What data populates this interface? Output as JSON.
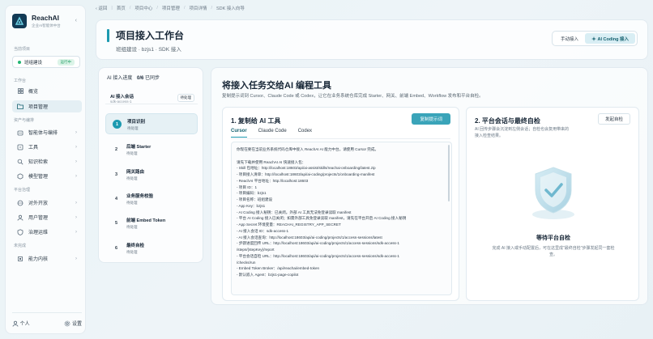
{
  "brand": {
    "name": "ReachAI",
    "subtitle": "企业AI智能体中台"
  },
  "sidebar": {
    "current_project_label": "当前项目",
    "project": {
      "name": "班组建设",
      "status": "运行中"
    },
    "groups": [
      {
        "label": "工作台"
      },
      {
        "label": "资产与编排"
      },
      {
        "label": "平台治理"
      },
      {
        "label": "未完成"
      }
    ],
    "items": [
      {
        "label": "概览",
        "icon": "grid-icon"
      },
      {
        "label": "项目管理",
        "icon": "folder-icon"
      },
      {
        "label": "智能体与编排",
        "icon": "robot-icon"
      },
      {
        "label": "工具",
        "icon": "tool-icon"
      },
      {
        "label": "知识检索",
        "icon": "search-icon"
      },
      {
        "label": "模型管理",
        "icon": "cube-icon"
      },
      {
        "label": "对外开放",
        "icon": "link-icon"
      },
      {
        "label": "用户管理",
        "icon": "user-icon"
      },
      {
        "label": "治理运维",
        "icon": "shield-icon"
      },
      {
        "label": "能力内核",
        "icon": "chip-icon"
      }
    ],
    "footer": {
      "personal": "个人",
      "settings": "设置"
    }
  },
  "breadcrumb": [
    "返回",
    "首页",
    "项目中心",
    "项目管理",
    "项目详情",
    "SDK 接入向导"
  ],
  "header": {
    "title": "项目接入工作台",
    "subtitle": "班组建设 · bzjs1 · SDK 接入",
    "mode_manual": "手动接入",
    "mode_ai": "AI Coding 接入"
  },
  "steps_panel": {
    "label": "AI 接入进度",
    "progress": "0/6",
    "status": "已同步",
    "session": {
      "title": "AI 接入会话",
      "id": "sdk-access-1",
      "badge": "待处理"
    },
    "steps": [
      {
        "num": "1",
        "title": "项目识别",
        "status": "待处理"
      },
      {
        "num": "2",
        "title": "后端 Starter",
        "status": "待处理"
      },
      {
        "num": "3",
        "title": "网关路由",
        "status": "待处理"
      },
      {
        "num": "4",
        "title": "业务服务校验",
        "status": "待处理"
      },
      {
        "num": "5",
        "title": "前端 Embed Token",
        "status": "待处理"
      },
      {
        "num": "6",
        "title": "最终自检",
        "status": "待处理"
      }
    ]
  },
  "main": {
    "title": "将接入任务交给AI 编程工具",
    "description": "复制提示词到 Cursor、Claude Code 或 Codex，让它在业务系统仓库完成 Starter、网关、前端 Embed、Workflow 发布和平台自检。",
    "card1": {
      "title": "1. 复制给 AI 工具",
      "copy_button": "复制提示词",
      "tabs": [
        "Cursor",
        "Claude Code",
        "Codex"
      ],
      "lines": [
        "你现在要在当前业务系统代码仓库中接入 ReachAI AI 能力中台。请使用 Cursor 完成。",
        "",
        "请先下载并使用 ReachAI AI 快速接入包：",
        "- Skill 包地址：http://localhost:18603/api/ai-assist/skills/reachai-onboarding/latest.zip",
        "- 项目接入清单：http://localhost:18603/api/ai-coding/projects/1/onboarding-manifest",
        "- ReachAI 平台地址：http://localhost:18603",
        "- 项目 ID：1",
        "- 项目编码：bzjs1",
        "- 项目名称：班组建设",
        "- App Key：bzjs1",
        "- AI Coding 接入秘钥：已关闭。外部 AI 工具无法免登录读取 manifest",
        "- 平台 AI Coding 接入已关闭；如需外部工具免登录读取 manifest，请先在平台开启 AI Coding 接入秘钥",
        "- App Secret 环境变量：REACHAI_REGISTRY_APP_SECRET",
        "- AI 接入会话 ID：sdk-access-1",
        "- AI 接入会话查询：http://localhost:18603/api/ai-coding/projects/1/access-sessions/latest",
        "- 步骤进度回传 URL：http://localhost:18603/api/ai-coding/projects/1/access-sessions/sdk-access-1",
        "/steps/{stepKey}/report",
        "- 平台会话自检 URL：http://localhost:18603/api/ai-coding/projects/1/access-sessions/sdk-access-1",
        "/checks/run",
        "- Embed Token Broker：/api/reachai/embed-token",
        "- 默认嵌入 Agent：bzjs1-page-copilot"
      ]
    },
    "card2": {
      "title": "2. 平台会话与最终自检",
      "button": "发起自检",
      "description": "AI 回传步骤会沉淀到左侧会话；自检也会复用带来的接入检查结果。",
      "wait_title": "等待平台自检",
      "wait_desc": "完成 AI 接入或手动配置后，可在这里成\"最终自检\"步骤发起同一套检查。"
    }
  },
  "colors": {
    "accent": "#1d9ab0",
    "button": "#3aa4b9",
    "running": "#22b573"
  }
}
